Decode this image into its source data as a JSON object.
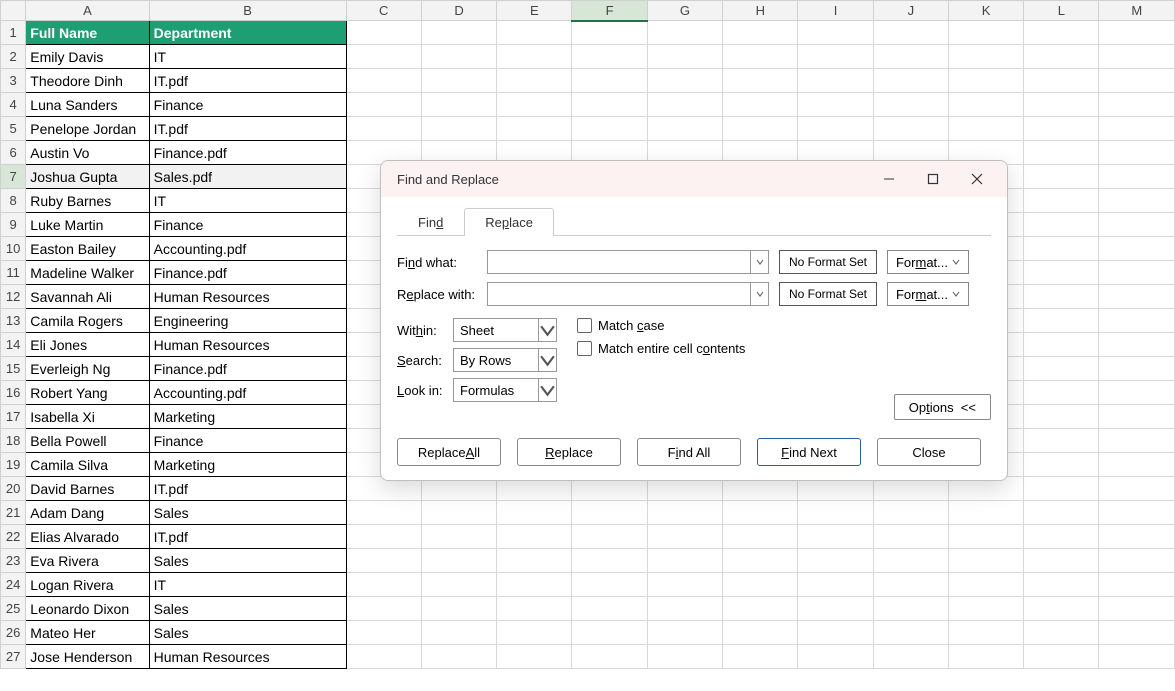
{
  "sheet": {
    "columns": [
      "A",
      "B",
      "C",
      "D",
      "E",
      "F",
      "G",
      "H",
      "I",
      "J",
      "K",
      "L",
      "M"
    ],
    "selected_column": "F",
    "selected_row": 7,
    "col_widths": {
      "A": 124,
      "B": 202,
      "other": 80
    },
    "headers": [
      "Full Name",
      "Department"
    ],
    "rows": [
      [
        "Emily Davis",
        "IT"
      ],
      [
        "Theodore Dinh",
        "IT.pdf"
      ],
      [
        "Luna Sanders",
        "Finance"
      ],
      [
        "Penelope Jordan",
        "IT.pdf"
      ],
      [
        "Austin Vo",
        "Finance.pdf"
      ],
      [
        "Joshua Gupta",
        "Sales.pdf"
      ],
      [
        "Ruby Barnes",
        "IT"
      ],
      [
        "Luke Martin",
        "Finance"
      ],
      [
        "Easton Bailey",
        "Accounting.pdf"
      ],
      [
        "Madeline Walker",
        "Finance.pdf"
      ],
      [
        "Savannah Ali",
        "Human Resources"
      ],
      [
        "Camila Rogers",
        "Engineering"
      ],
      [
        "Eli Jones",
        "Human Resources"
      ],
      [
        "Everleigh Ng",
        "Finance.pdf"
      ],
      [
        "Robert Yang",
        "Accounting.pdf"
      ],
      [
        "Isabella Xi",
        "Marketing"
      ],
      [
        "Bella Powell",
        "Finance"
      ],
      [
        "Camila Silva",
        "Marketing"
      ],
      [
        "David Barnes",
        "IT.pdf"
      ],
      [
        "Adam Dang",
        "Sales"
      ],
      [
        "Elias Alvarado",
        "IT.pdf"
      ],
      [
        "Eva Rivera",
        "Sales"
      ],
      [
        "Logan Rivera",
        "IT"
      ],
      [
        "Leonardo Dixon",
        "Sales"
      ],
      [
        "Mateo Her",
        "Sales"
      ],
      [
        "Jose Henderson",
        "Human Resources"
      ]
    ]
  },
  "dialog": {
    "title": "Find and Replace",
    "tabs": {
      "find": "Find",
      "replace": "Replace",
      "active": "replace"
    },
    "find_what_label": "Find what:",
    "replace_with_label": "Replace with:",
    "find_what_value": "",
    "replace_with_value": "",
    "no_format": "No Format Set",
    "format_btn": "Format...",
    "within_label": "Within:",
    "within_value": "Sheet",
    "search_label": "Search:",
    "search_value": "By Rows",
    "lookin_label": "Look in:",
    "lookin_value": "Formulas",
    "match_case": "Match case",
    "match_entire": "Match entire cell contents",
    "options_btn": "Options <<",
    "buttons": {
      "replace_all": "Replace All",
      "replace": "Replace",
      "find_all": "Find All",
      "find_next": "Find Next",
      "close": "Close"
    }
  }
}
